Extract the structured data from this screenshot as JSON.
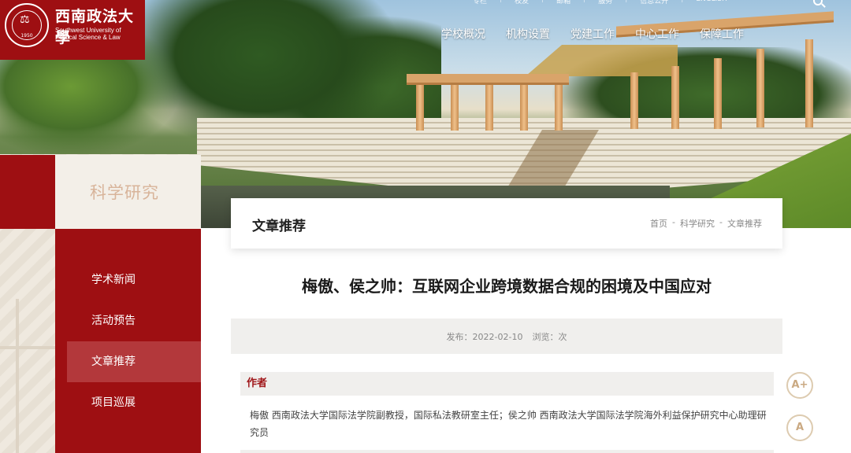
{
  "brand": {
    "name_cn": "西南政法大學",
    "name_en_line1": "Southwest University of",
    "name_en_line2": "Political Science & Law",
    "seal_year": "1950",
    "color": "#9e0f12"
  },
  "topbar": {
    "links": [
      "专栏",
      "校友",
      "邮箱",
      "服务",
      "信息公开",
      "ENGLISH"
    ],
    "search_icon": "search-icon"
  },
  "nav": {
    "items": [
      "学校概况",
      "机构设置",
      "党建工作",
      "中心工作",
      "保障工作"
    ]
  },
  "sidebar": {
    "section_title": "科学研究",
    "items": [
      {
        "label": "学术新闻",
        "active": false
      },
      {
        "label": "活动预告",
        "active": false
      },
      {
        "label": "文章推荐",
        "active": true
      },
      {
        "label": "项目巡展",
        "active": false
      }
    ]
  },
  "card": {
    "title": "文章推荐",
    "breadcrumb": [
      "首页",
      "-",
      "科学研究",
      "-",
      "文章推荐"
    ]
  },
  "article": {
    "title": "梅傲、侯之帅：互联网企业跨境数据合规的困境及中国应对",
    "publish": "发布：2022-02-10",
    "views": "浏览：次",
    "author_heading": "作者",
    "author_text": "梅傲 西南政法大学国际法学院副教授，国际私法教研室主任；侯之帅 西南政法大学国际法学院海外利益保护研究中心助理研究员"
  },
  "tools": {
    "font_larger": "A+",
    "font_normal": "A"
  }
}
